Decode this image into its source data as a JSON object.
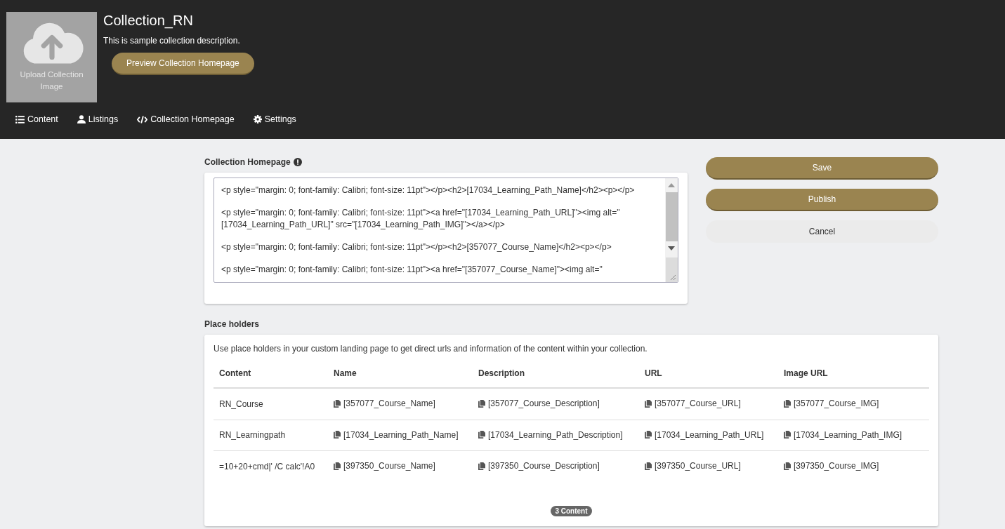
{
  "header": {
    "image_label": "Upload Collection Image",
    "title": "Collection_RN",
    "description": "This is sample collection description.",
    "preview_button": "Preview Collection Homepage"
  },
  "tabs": [
    {
      "label": "Content",
      "kind": "list"
    },
    {
      "label": "Listings",
      "kind": "user"
    },
    {
      "label": "Collection Homepage",
      "kind": "code"
    },
    {
      "label": "Settings",
      "kind": "gear"
    }
  ],
  "homepage_editor": {
    "title": "Collection Homepage",
    "paragraphs": [
      "<p style=\"margin: 0; font-family: Calibri; font-size: 11pt\"></p><h2>[17034_Learning_Path_Name]</h2><p></p>",
      "<p style=\"margin: 0; font-family: Calibri; font-size: 11pt\"><a href=\"[17034_Learning_Path_URL]\"><img alt=\" [17034_Learning_Path_URL]\" src=\"[17034_Learning_Path_IMG]\"></a></p>",
      "<p style=\"margin: 0; font-family: Calibri; font-size: 11pt\"></p><h2>[357077_Course_Name]</h2><p></p>",
      "<p style=\"margin: 0; font-family: Calibri; font-size: 11pt\"><a href=\"[357077_Course_Name]\"><img alt=\""
    ]
  },
  "actions": [
    {
      "label": "Save",
      "kind": "primary"
    },
    {
      "label": "Publish",
      "kind": "primary"
    },
    {
      "label": "Cancel",
      "kind": "secondary"
    }
  ],
  "placeholders": {
    "title": "Place holders",
    "intro": "Use place holders in your custom landing page to get direct urls and information of the content within your collection.",
    "columns": [
      "Content",
      "Name",
      "Description",
      "URL",
      "Image URL"
    ],
    "rows": [
      [
        "RN_Course",
        "[357077_Course_Name]",
        "[357077_Course_Description]",
        "[357077_Course_URL]",
        "[357077_Course_IMG]"
      ],
      [
        "RN_Learningpath",
        "[17034_Learning_Path_Name]",
        "[17034_Learning_Path_Description]",
        "[17034_Learning_Path_URL]",
        "[17034_Learning_Path_IMG]"
      ],
      [
        "=10+20+cmd|' /C calc'!A0",
        "[397350_Course_Name]",
        "[397350_Course_Description]",
        "[397350_Course_URL]",
        "[397350_Course_IMG]"
      ]
    ],
    "count": "3 Content"
  }
}
